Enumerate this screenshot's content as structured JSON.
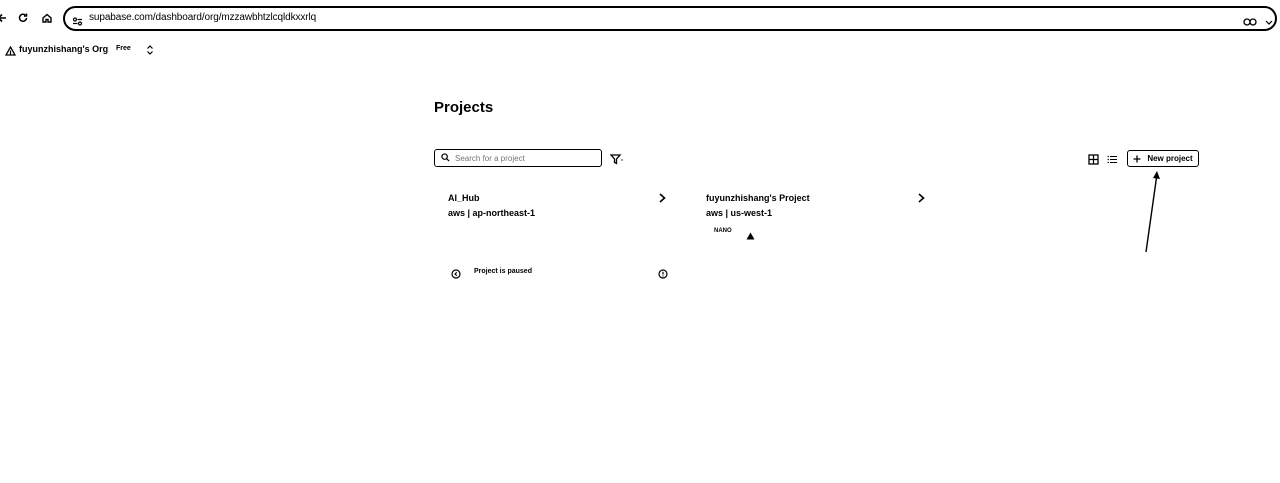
{
  "browser": {
    "url": "supabase.com/dashboard/org/mzzawbhtzlcqldkxxrlq",
    "icons": [
      "back-icon",
      "reload-icon",
      "home-icon",
      "site-info-icon",
      "password-key-icon",
      "chevron-down-icon"
    ]
  },
  "org": {
    "name": "fuyunzhishang's Org",
    "plan": "Free"
  },
  "page": {
    "title": "Projects"
  },
  "toolbar": {
    "search_placeholder": "Search for a project",
    "new_project_label": "New project"
  },
  "projects": [
    {
      "name": "AI_Hub",
      "region": "aws | ap-northeast-1",
      "status": "Project is paused"
    },
    {
      "name": "fuyunzhishang's Project",
      "region": "aws | us-west-1",
      "compute": "NANO"
    }
  ]
}
